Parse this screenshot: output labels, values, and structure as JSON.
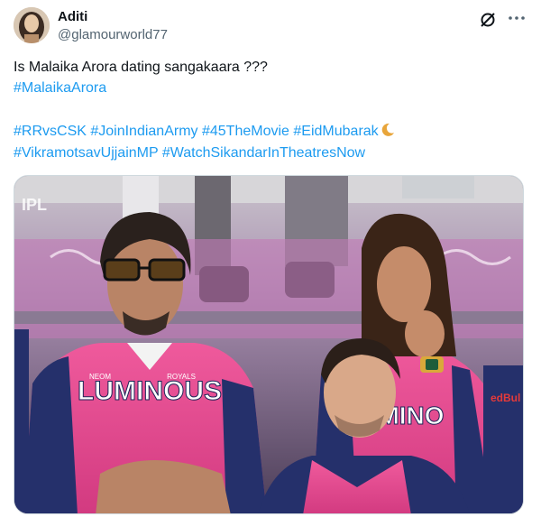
{
  "tweet": {
    "author_name": "Aditi",
    "author_handle": "@glamourworld77",
    "text_line1": "Is Malaika Arora dating sangakaara ???",
    "hashtags_line2": [
      "#MalaikaArora"
    ],
    "hashtags_line3": [
      "#RRvsCSK",
      "#JoinIndianArmy",
      "#45TheMovie",
      "#EidMubarak"
    ],
    "hashtags_line4": [
      "#VikramotsavUjjainMP",
      "#WatchSikandarInTheatresNow"
    ]
  },
  "media": {
    "jersey_left_text": "LUMINOUS",
    "jersey_right_text": "MINO",
    "watermark": "IPL",
    "sleeve_text": "edBul",
    "small_logo_text": "NEOM",
    "royals_text": "ROYALS"
  },
  "colors": {
    "hashtag": "#1d9bf0",
    "secondary_text": "#536471",
    "jersey_pink": "#e2498f",
    "jersey_navy": "#25306b"
  },
  "icons": {
    "grok": "grok-icon",
    "more": "more-icon",
    "moon": "crescent-moon-emoji"
  }
}
